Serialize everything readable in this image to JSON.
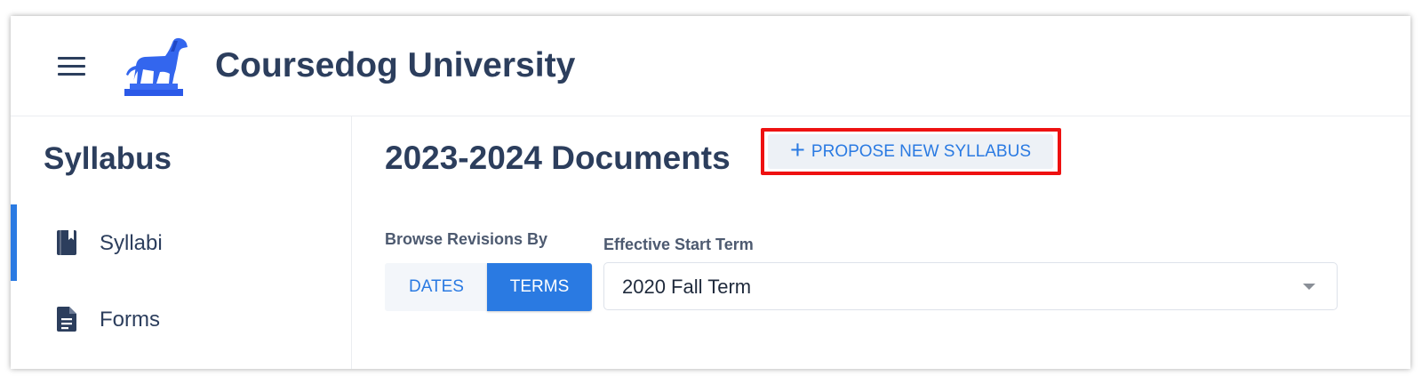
{
  "header": {
    "app_title": "Coursedog University",
    "menu_icon": "hamburger-menu-icon",
    "logo_icon": "dog-statue-logo"
  },
  "sidebar": {
    "title": "Syllabus",
    "items": [
      {
        "label": "Syllabi",
        "icon": "book-icon",
        "active": true
      },
      {
        "label": "Forms",
        "icon": "document-icon",
        "active": false
      }
    ]
  },
  "main": {
    "page_title": "2023-2024 Documents",
    "propose_button": {
      "icon": "plus-icon",
      "label": "PROPOSE NEW SYLLABUS"
    },
    "browse_label": "Browse Revisions By",
    "toggle": {
      "options": [
        "DATES",
        "TERMS"
      ],
      "selected": "TERMS"
    },
    "term_label": "Effective Start Term",
    "term_select": {
      "value": "2020 Fall Term"
    }
  },
  "colors": {
    "primary": "#2a7ae2",
    "heading": "#2c3e5d",
    "highlight": "#ee1111"
  }
}
